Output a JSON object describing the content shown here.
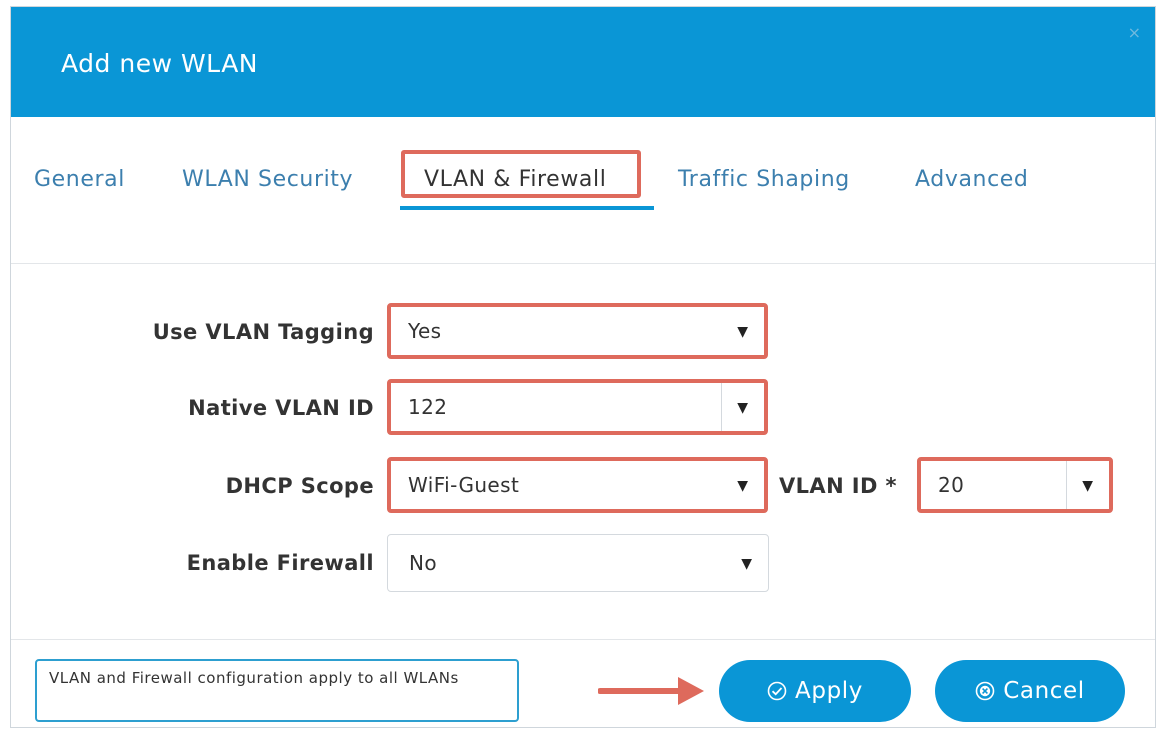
{
  "dialog": {
    "title": "Add new WLAN",
    "close_glyph": "×"
  },
  "tabs": [
    {
      "label": "General",
      "active": false
    },
    {
      "label": "WLAN Security",
      "active": false
    },
    {
      "label": "VLAN & Firewall",
      "active": true
    },
    {
      "label": "Traffic Shaping",
      "active": false
    },
    {
      "label": "Advanced",
      "active": false
    }
  ],
  "form": {
    "use_vlan_tagging": {
      "label": "Use VLAN Tagging",
      "value": "Yes"
    },
    "native_vlan_id": {
      "label": "Native VLAN ID",
      "value": "122"
    },
    "dhcp_scope": {
      "label": "DHCP Scope",
      "value": "WiFi-Guest"
    },
    "vlan_id": {
      "label": "VLAN ID *",
      "value": "20"
    },
    "enable_firewall": {
      "label": "Enable Firewall",
      "value": "No"
    }
  },
  "footer": {
    "note": "VLAN and Firewall configuration apply to all WLANs",
    "apply_label": "Apply",
    "cancel_label": "Cancel"
  },
  "colors": {
    "header": "#0a96d6",
    "tab_link": "#3c7fae",
    "highlight": "#de6a5c",
    "button": "#0a96d6"
  },
  "icons": {
    "close": "close-icon",
    "dropdown": "caret-down-icon",
    "apply": "check-circle-icon",
    "cancel": "x-circle-icon",
    "arrow": "arrow-right-icon"
  }
}
